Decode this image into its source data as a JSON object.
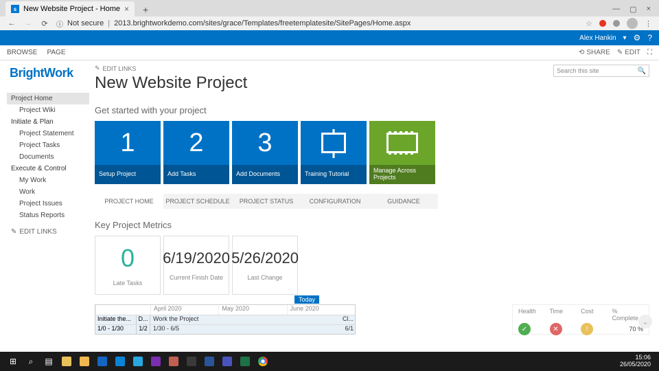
{
  "browser": {
    "tab_title": "New Website Project - Home",
    "not_secure": "Not secure",
    "url": "2013.brightworkdemo.com/sites/grace/Templates/freetemplatesite/SitePages/Home.aspx"
  },
  "suite": {
    "user": "Alex Hankin"
  },
  "ribbon": {
    "browse": "BROWSE",
    "page": "PAGE",
    "share": "SHARE",
    "edit": "EDIT"
  },
  "logo": "BrightWork",
  "nav": {
    "project_home": "Project Home",
    "project_wiki": "Project Wiki",
    "initiate_plan": "Initiate & Plan",
    "project_statement": "Project Statement",
    "project_tasks": "Project Tasks",
    "documents": "Documents",
    "execute_control": "Execute & Control",
    "my_work": "My Work",
    "work": "Work",
    "project_issues": "Project Issues",
    "status_reports": "Status Reports",
    "edit_links": "EDIT LINKS"
  },
  "page": {
    "edit_links": "EDIT LINKS",
    "title": "New Website Project",
    "search_placeholder": "Search this site",
    "get_started": "Get started with your project"
  },
  "tiles": [
    {
      "num": "1",
      "label": "Setup Project"
    },
    {
      "num": "2",
      "label": "Add Tasks"
    },
    {
      "num": "3",
      "label": "Add Documents"
    },
    {
      "icon": "easel",
      "label": "Training Tutorial"
    },
    {
      "icon": "film",
      "label": "Manage Across Projects",
      "green": true
    }
  ],
  "subtabs": {
    "home": "PROJECT HOME",
    "schedule": "PROJECT SCHEDULE",
    "status": "PROJECT STATUS",
    "config": "CONFIGURATION",
    "guidance": "GUIDANCE"
  },
  "metrics_heading": "Key Project Metrics",
  "metrics": [
    {
      "value": "0",
      "label": "Late Tasks",
      "big": true
    },
    {
      "value": "6/19/2020",
      "label": "Current Finish Date"
    },
    {
      "value": "5/26/2020",
      "label": "Last Change"
    }
  ],
  "gantt": {
    "today": "Today",
    "months": [
      "April 2020",
      "May 2020",
      "June 2020"
    ],
    "rows": [
      {
        "name": "Initiate the...",
        "d": "D...",
        "task": "Work the Project",
        "cl": "Cl..."
      },
      {
        "name": "1/0 - 1/30",
        "d": "1/2",
        "task": "1/30 - 6/5",
        "cl": "6/1"
      }
    ]
  },
  "health": {
    "h1": "Health",
    "h2": "Time",
    "h3": "Cost",
    "h4": "% Complete",
    "pct": "70 %"
  },
  "taskbar": {
    "time": "15:06",
    "date": "26/05/2020"
  }
}
